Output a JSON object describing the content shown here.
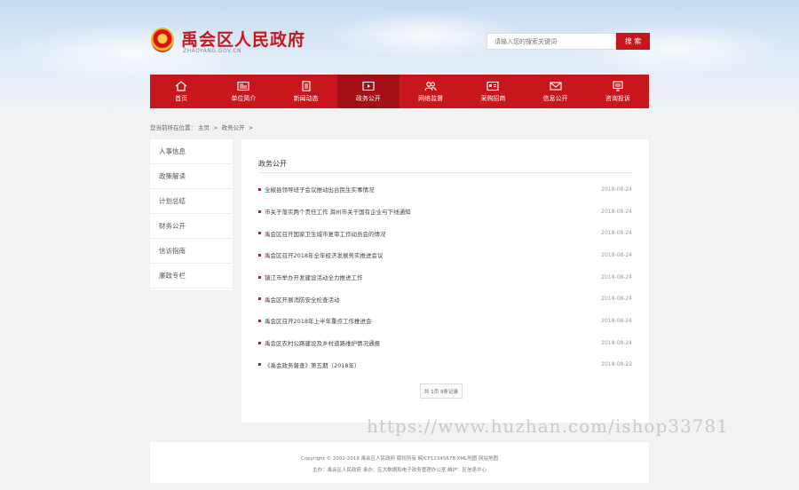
{
  "site": {
    "title": "禹会区人民政府",
    "domain": "ZHAOYANG.GOV.CN"
  },
  "search": {
    "placeholder": "请输入您的搜索关键词",
    "button": "搜 索"
  },
  "nav": {
    "items": [
      {
        "label": "首页",
        "icon": "home-icon"
      },
      {
        "label": "单位简介",
        "icon": "newspaper-icon"
      },
      {
        "label": "新闻动态",
        "icon": "document-icon"
      },
      {
        "label": "政务公开",
        "icon": "video-icon",
        "active": true
      },
      {
        "label": "网络监督",
        "icon": "people-icon"
      },
      {
        "label": "采购招商",
        "icon": "id-card-icon"
      },
      {
        "label": "信息公开",
        "icon": "mail-icon"
      },
      {
        "label": "咨询投诉",
        "icon": "monitor-icon"
      }
    ]
  },
  "breadcrumb": {
    "prefix": "您当前所在位置：",
    "home": "主页",
    "sep1": ">",
    "current": "政务公开",
    "sep2": ">"
  },
  "sidebar": {
    "items": [
      "人事信息",
      "政策解读",
      "计划总结",
      "财务公开",
      "信访指南",
      "廉政专栏"
    ]
  },
  "main": {
    "title": "政务公开",
    "articles": [
      {
        "title": "全椒县领导班子会议推动出台民生实事情况",
        "date": "2018-08-24"
      },
      {
        "title": "市关于落实两个责任工作 滁州市关于国有企业与下线通知",
        "date": "2018-08-24"
      },
      {
        "title": "禹会区召开国家卫生城市复审工作动员会的情况",
        "date": "2018-08-24"
      },
      {
        "title": "禹会区召开2018年全年经济发展务实推进会议",
        "date": "2018-08-24"
      },
      {
        "title": "镇江市举办开发建设活动全力推进工作",
        "date": "2018-08-24"
      },
      {
        "title": "禹会区开展消防安全检查活动",
        "date": "2018-08-24"
      },
      {
        "title": "禹会区召开2018年上半年重点工作推进会",
        "date": "2018-08-24"
      },
      {
        "title": "禹会区农村公路建设及乡村道路维护情况通报",
        "date": "2018-08-24"
      },
      {
        "title": "《禹会政务督查》第五期（2018年）",
        "date": "2018-08-23"
      }
    ],
    "pager": "共 1页 9条记录"
  },
  "footer": {
    "line1": "Copyright © 2002-2018 禹会区人民政府 版权所有 皖ICP12345678 XML地图 网站地图",
    "line2": "主办：禹会区人民政府 承办：区大数据和电子政务管理办公室 维护：区信息中心"
  },
  "watermark": "https://www.huzhan.com/ishop33781",
  "colors": {
    "brand": "#c8161d",
    "nav_active": "#a30f15"
  }
}
